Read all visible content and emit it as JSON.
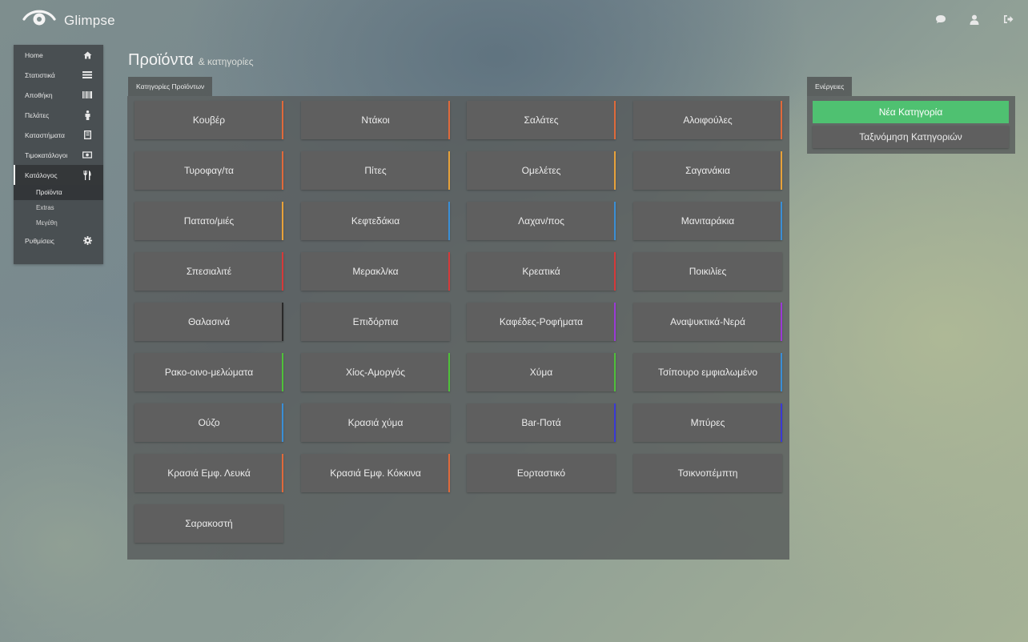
{
  "app": {
    "name": "Glimpse"
  },
  "header": {
    "icons": [
      {
        "name": "chat-icon"
      },
      {
        "name": "user-icon"
      },
      {
        "name": "logout-icon"
      }
    ]
  },
  "sidebar": {
    "items": [
      {
        "label": "Home",
        "icon": "home-icon"
      },
      {
        "label": "Στατιστικά",
        "icon": "stats-icon"
      },
      {
        "label": "Αποθήκη",
        "icon": "barcode-icon"
      },
      {
        "label": "Πελάτες",
        "icon": "person-icon"
      },
      {
        "label": "Καταστήματα",
        "icon": "store-icon"
      },
      {
        "label": "Τιμοκατάλογοι",
        "icon": "money-icon"
      },
      {
        "label": "Κατάλογος",
        "icon": "cutlery-icon",
        "active": true
      },
      {
        "label": "Ρυθμίσεις",
        "icon": "gear-icon"
      }
    ],
    "subitems": [
      {
        "label": "Προϊόντα",
        "active": true
      },
      {
        "label": "Extras"
      },
      {
        "label": "Μεγέθη"
      }
    ]
  },
  "page": {
    "title": "Προϊόντα",
    "subtitle": "& κατηγορίες"
  },
  "categories_panel": {
    "tab": "Κατηγορίες Προϊόντων",
    "items": [
      {
        "label": "Κουβέρ",
        "color": "#e06a3b"
      },
      {
        "label": "Ντάκοι",
        "color": "#e06a3b"
      },
      {
        "label": "Σαλάτες",
        "color": "#e06a3b"
      },
      {
        "label": "Αλοιφούλες",
        "color": "#e06a3b"
      },
      {
        "label": "Τυροφαγ/τα",
        "color": "#e06a3b"
      },
      {
        "label": "Πίτες",
        "color": "#e8a23a"
      },
      {
        "label": "Ομελέτες",
        "color": "#e8a23a"
      },
      {
        "label": "Σαγανάκια",
        "color": "#e8a23a"
      },
      {
        "label": "Πατατο/μιές",
        "color": "#e8a23a"
      },
      {
        "label": "Κεφτεδάκια",
        "color": "#3a8fd6"
      },
      {
        "label": "Λαχαν/πος",
        "color": "#3a8fd6"
      },
      {
        "label": "Μανιταράκια",
        "color": "#3a8fd6"
      },
      {
        "label": "Σπεσιαλιτέ",
        "color": "#d63a3a"
      },
      {
        "label": "Μερακλ/κα",
        "color": "#d63a3a"
      },
      {
        "label": "Κρεατικά",
        "color": "#d63a3a"
      },
      {
        "label": "Ποικιλίες",
        "color": ""
      },
      {
        "label": "Θαλασινά",
        "color": "#2a2a2a"
      },
      {
        "label": "Επιδόρπια",
        "color": ""
      },
      {
        "label": "Καφέδες-Ροφήματα",
        "color": "#9b3ad6"
      },
      {
        "label": "Αναψυκτικά-Νερά",
        "color": "#9b3ad6"
      },
      {
        "label": "Ρακο-οινο-μελώματα",
        "color": "#4fc13a"
      },
      {
        "label": "Χίος-Αμοργός",
        "color": "#4fc13a"
      },
      {
        "label": "Χύμα",
        "color": "#4fc13a"
      },
      {
        "label": "Τσίπουρο εμφιαλωμένο",
        "color": "#3a8fd6"
      },
      {
        "label": "Ούζο",
        "color": "#3a8fd6"
      },
      {
        "label": "Κρασιά χύμα",
        "color": ""
      },
      {
        "label": "Bar-Ποτά",
        "color": "#3a3ad6"
      },
      {
        "label": "Μπύρες",
        "color": "#3a3ad6"
      },
      {
        "label": "Κρασιά Εμφ. Λευκά",
        "color": "#e06a3b"
      },
      {
        "label": "Κρασιά Εμφ. Κόκκινα",
        "color": "#e06a3b"
      },
      {
        "label": "Εορταστικό",
        "color": ""
      },
      {
        "label": "Τσικνοπέμπτη",
        "color": ""
      },
      {
        "label": "Σαρακοστή",
        "color": ""
      }
    ]
  },
  "actions_panel": {
    "tab": "Ενέργειες",
    "new_category": "Νέα Κατηγορία",
    "sort_categories": "Ταξινόμηση Κατηγοριών"
  }
}
